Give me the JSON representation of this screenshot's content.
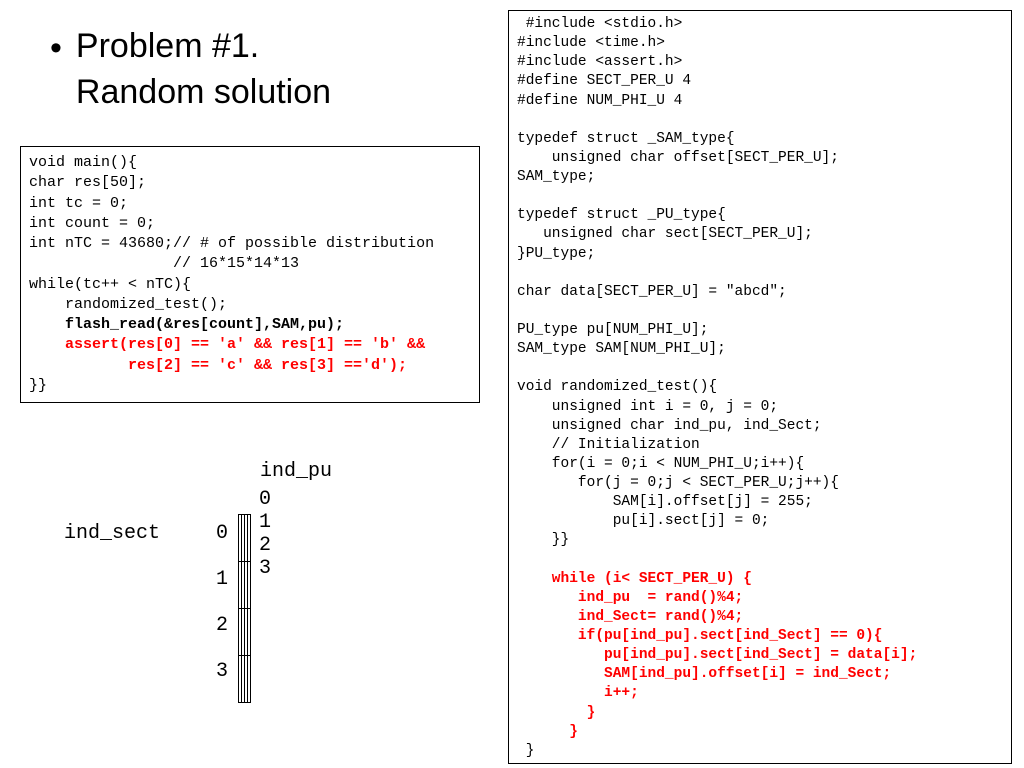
{
  "title_line1": "Problem #1.",
  "title_line2": "Random solution",
  "code_left": {
    "l1": "void main(){",
    "l2": "char res[50];",
    "l3": "int tc = 0;",
    "l4": "int count = 0;",
    "l5": "int nTC = 43680;// # of possible distribution",
    "l6": "                // 16*15*14*13",
    "l7": "while(tc++ < nTC){",
    "l8": "    randomized_test();",
    "l9": "    flash_read(&res[count],SAM,pu);",
    "l10": "    assert(res[0] == 'a' && res[1] == 'b' &&",
    "l11": "           res[2] == 'c' && res[3] =='d');",
    "l12": "}}"
  },
  "code_right": {
    "r1": " #include <stdio.h>",
    "r2": "#include <time.h>",
    "r3": "#include <assert.h>",
    "r4": "#define SECT_PER_U 4",
    "r5": "#define NUM_PHI_U 4",
    "r6": "",
    "r7": "typedef struct _SAM_type{",
    "r8": "    unsigned char offset[SECT_PER_U];",
    "r9": "SAM_type;",
    "r10": "",
    "r11": "typedef struct _PU_type{",
    "r12": "   unsigned char sect[SECT_PER_U];",
    "r13": "}PU_type;",
    "r14": "",
    "r15": "char data[SECT_PER_U] = \"abcd\";",
    "r16": "",
    "r17": "PU_type pu[NUM_PHI_U];",
    "r18": "SAM_type SAM[NUM_PHI_U];",
    "r19": "",
    "r20": "void randomized_test(){",
    "r21": "    unsigned int i = 0, j = 0;",
    "r22": "    unsigned char ind_pu, ind_Sect;",
    "r23": "    // Initialization",
    "r24": "    for(i = 0;i < NUM_PHI_U;i++){",
    "r25": "       for(j = 0;j < SECT_PER_U;j++){",
    "r26": "           SAM[i].offset[j] = 255;",
    "r27": "           pu[i].sect[j] = 0;",
    "r28": "    }}",
    "r29": "",
    "r30": "    while (i< SECT_PER_U) {",
    "r31": "       ind_pu  = rand()%4;",
    "r32": "       ind_Sect= rand()%4;",
    "r33": "       if(pu[ind_pu].sect[ind_Sect] == 0){",
    "r34": "          pu[ind_pu].sect[ind_Sect] = data[i];",
    "r35": "          SAM[ind_pu].offset[i] = ind_Sect;",
    "r36": "          i++;",
    "r37": "        }",
    "r38": "      }",
    "r39": " }"
  },
  "grid": {
    "ind_pu_label": "ind_pu",
    "ind_sect_label": "ind_sect",
    "cols": [
      "0",
      "1",
      "2",
      "3"
    ],
    "rows": [
      "0",
      "1",
      "2",
      "3"
    ]
  }
}
